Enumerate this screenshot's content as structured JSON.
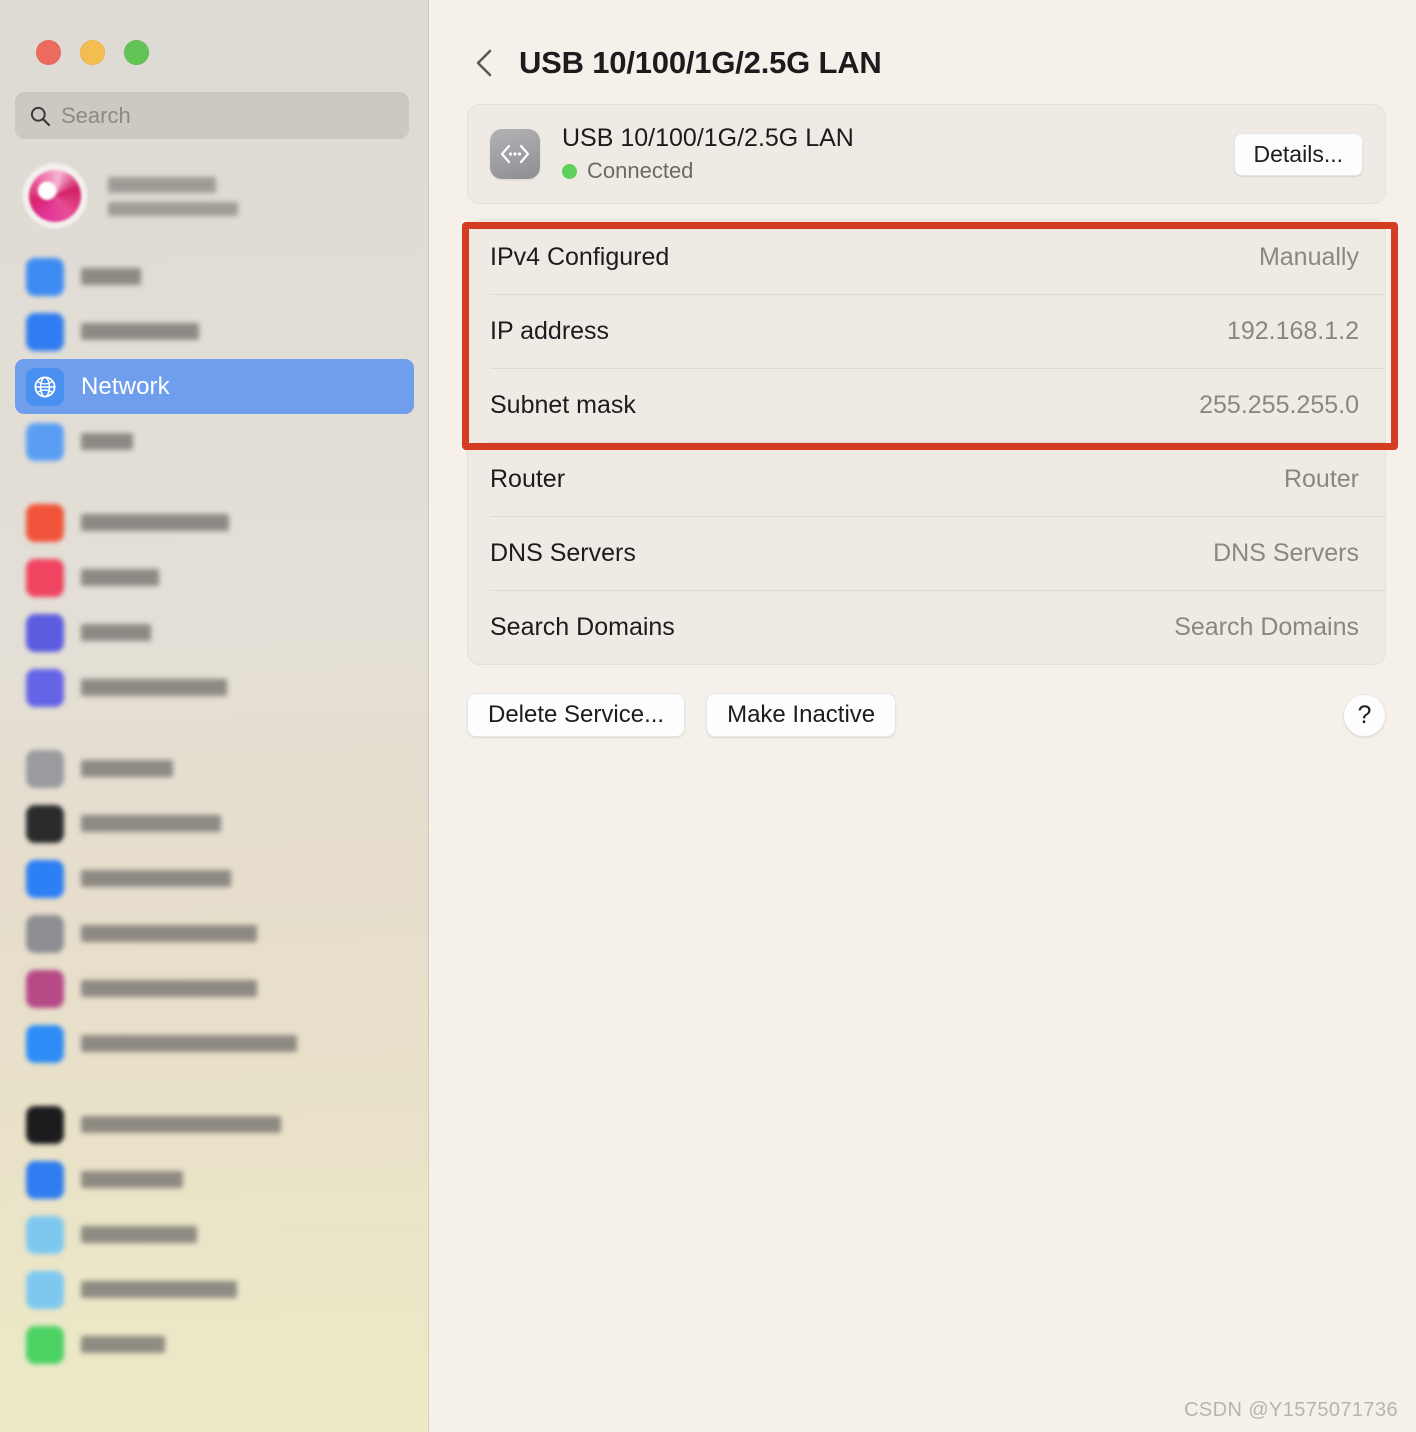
{
  "window": {
    "traffic_lights": [
      {
        "name": "close",
        "color": "#ec6a5e"
      },
      {
        "name": "minimize",
        "color": "#f4bd4f"
      },
      {
        "name": "zoom",
        "color": "#61c454"
      }
    ]
  },
  "sidebar": {
    "search": {
      "placeholder": "Search",
      "value": "",
      "icon": "search-icon"
    },
    "profile": {
      "name_redacted": true,
      "subtitle_redacted": true,
      "avatar_redacted": true
    },
    "groups": [
      {
        "items": [
          {
            "label": "",
            "redacted": true,
            "icon_color": "#3d8bf2",
            "selected": false,
            "blur_width": 60
          },
          {
            "label": "",
            "redacted": true,
            "icon_color": "#2f7df0",
            "selected": false,
            "blur_width": 118
          },
          {
            "label": "Network",
            "redacted": false,
            "icon_color": "#4a90f0",
            "selected": true,
            "icon": "globe-icon"
          },
          {
            "label": "",
            "redacted": true,
            "icon_color": "#5a9ef4",
            "selected": false,
            "blur_width": 52
          }
        ]
      },
      {
        "items": [
          {
            "label": "",
            "redacted": true,
            "icon_color": "#f0543a",
            "selected": false,
            "blur_width": 148
          },
          {
            "label": "",
            "redacted": true,
            "icon_color": "#ef4560",
            "selected": false,
            "blur_width": 78
          },
          {
            "label": "",
            "redacted": true,
            "icon_color": "#5b5ce0",
            "selected": false,
            "blur_width": 70
          },
          {
            "label": "",
            "redacted": true,
            "icon_color": "#6464e6",
            "selected": false,
            "blur_width": 146
          }
        ]
      },
      {
        "items": [
          {
            "label": "",
            "redacted": true,
            "icon_color": "#9a9a9f",
            "selected": false,
            "blur_width": 92
          },
          {
            "label": "",
            "redacted": true,
            "icon_color": "#2b2b2e",
            "selected": false,
            "blur_width": 140
          },
          {
            "label": "",
            "redacted": true,
            "icon_color": "#2d7ff5",
            "selected": false,
            "blur_width": 150
          },
          {
            "label": "",
            "redacted": true,
            "icon_color": "#8e8e93",
            "selected": false,
            "blur_width": 176
          },
          {
            "label": "",
            "redacted": true,
            "icon_color": "#b54a86",
            "selected": false,
            "blur_width": 176
          },
          {
            "label": "",
            "redacted": true,
            "icon_color": "#2d8cf5",
            "selected": false,
            "blur_width": 216
          }
        ]
      },
      {
        "items": [
          {
            "label": "",
            "redacted": true,
            "icon_color": "#1c1c1e",
            "selected": false,
            "blur_width": 200
          },
          {
            "label": "",
            "redacted": true,
            "icon_color": "#2f7df0",
            "selected": false,
            "blur_width": 102
          },
          {
            "label": "",
            "redacted": true,
            "icon_color": "#7ec8ef",
            "selected": false,
            "blur_width": 116
          },
          {
            "label": "",
            "redacted": true,
            "icon_color": "#7ec8ef",
            "selected": false,
            "blur_width": 156
          },
          {
            "label": "",
            "redacted": true,
            "icon_color": "#4bd263",
            "selected": false,
            "blur_width": 84
          }
        ]
      }
    ]
  },
  "main": {
    "back_icon": "chevron-left-icon",
    "title": "USB 10/100/1G/2.5G LAN",
    "interface": {
      "icon": "ethernet-adapter-icon",
      "name": "USB 10/100/1G/2.5G LAN",
      "status": "Connected",
      "status_dot_color": "#5dd159",
      "details_button": "Details..."
    },
    "rows": [
      {
        "label": "IPv4 Configured",
        "value": "Manually",
        "highlighted": true
      },
      {
        "label": "IP address",
        "value": "192.168.1.2",
        "highlighted": true
      },
      {
        "label": "Subnet mask",
        "value": "255.255.255.0",
        "highlighted": true
      },
      {
        "label": "Router",
        "value": "Router",
        "highlighted": false
      },
      {
        "label": "DNS Servers",
        "value": "DNS Servers",
        "highlighted": false
      },
      {
        "label": "Search Domains",
        "value": "Search Domains",
        "highlighted": false
      }
    ],
    "highlight_color": "#d33b23",
    "buttons": {
      "delete_service": "Delete Service...",
      "make_inactive": "Make Inactive",
      "help": "?"
    }
  },
  "watermark": "CSDN @Y1575071736"
}
